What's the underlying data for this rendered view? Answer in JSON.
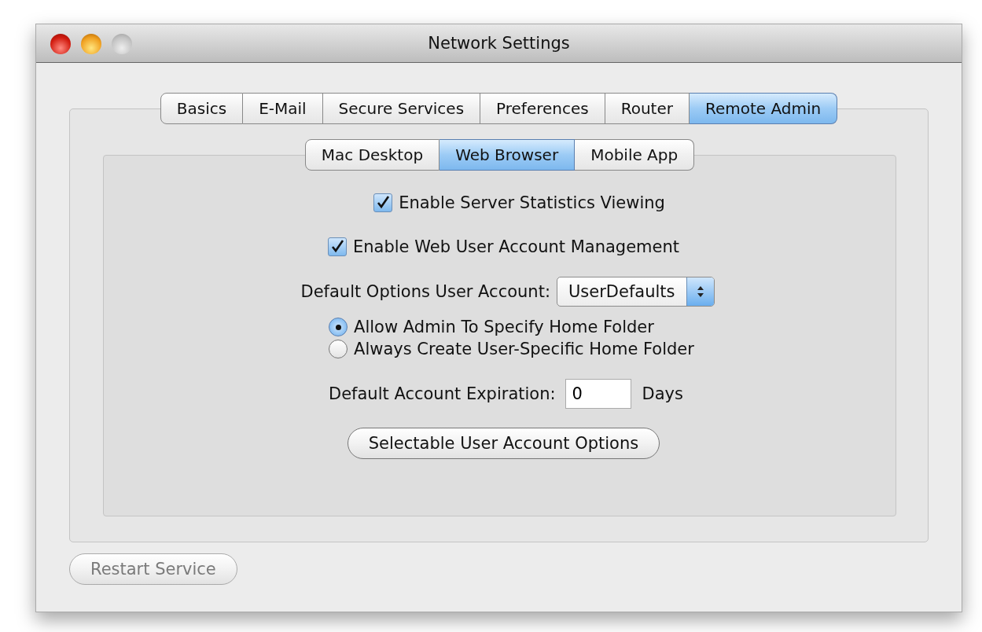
{
  "window": {
    "title": "Network Settings"
  },
  "tabs": [
    {
      "label": "Basics",
      "selected": false
    },
    {
      "label": "E-Mail",
      "selected": false
    },
    {
      "label": "Secure Services",
      "selected": false
    },
    {
      "label": "Preferences",
      "selected": false
    },
    {
      "label": "Router",
      "selected": false
    },
    {
      "label": "Remote Admin",
      "selected": true
    }
  ],
  "subtabs": [
    {
      "label": "Mac Desktop",
      "selected": false
    },
    {
      "label": "Web Browser",
      "selected": true
    },
    {
      "label": "Mobile App",
      "selected": false
    }
  ],
  "checkboxes": [
    {
      "label": "Enable Server Statistics Viewing",
      "checked": true
    },
    {
      "label": "Enable Web User Account Management",
      "checked": true
    }
  ],
  "default_account": {
    "label": "Default Options User Account:",
    "value": "UserDefaults"
  },
  "home_folder_options": [
    {
      "label": "Allow Admin To Specify Home Folder",
      "selected": true
    },
    {
      "label": "Always Create User-Specific Home Folder",
      "selected": false
    }
  ],
  "expiration": {
    "label": "Default Account Expiration:",
    "value": "0",
    "unit": "Days"
  },
  "options_button": {
    "label": "Selectable User Account Options",
    "disabled": false
  },
  "restart_button": {
    "label": "Restart Service",
    "disabled": true
  }
}
